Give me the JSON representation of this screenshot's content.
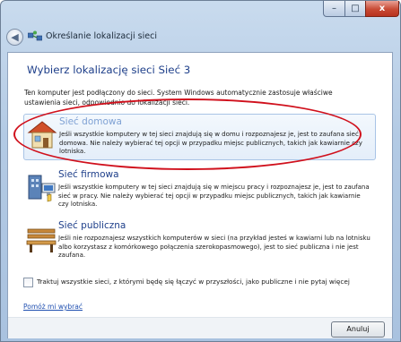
{
  "window": {
    "title": "Określanie lokalizacji sieci",
    "controls": {
      "minimize": "–",
      "maximize": "□",
      "close": "x"
    }
  },
  "heading": "Wybierz lokalizację sieci Sieć 3",
  "intro": "Ten komputer jest podłączony do sieci. System Windows automatycznie zastosuje właściwe ustawienia sieci, odpowiednio do lokalizacji sieci.",
  "options": [
    {
      "title": "Sieć domowa",
      "description": "Jeśli wszystkie komputery w tej sieci znajdują się w domu i rozpoznajesz je, jest to zaufana sieć domowa. Nie należy wybierać tej opcji w przypadku miejsc publicznych, takich jak kawiarnie czy lotniska.",
      "icon": "house-icon"
    },
    {
      "title": "Sieć firmowa",
      "description": "Jeśli wszystkie komputery w tej sieci znajdują się w miejscu pracy i rozpoznajesz je, jest to zaufana sieć w pracy. Nie należy wybierać tej opcji w przypadku miejsc publicznych, takich jak kawiarnie czy lotniska.",
      "icon": "office-network-icon"
    },
    {
      "title": "Sieć publiczna",
      "description": "Jeśli nie rozpoznajesz wszystkich komputerów w sieci (na przykład jesteś w kawiarni lub na lotnisku albo korzystasz z komórkowego połączenia szerokopasmowego), jest to sieć publiczna i nie jest zaufana.",
      "icon": "park-bench-icon"
    }
  ],
  "checkbox": {
    "label": "Traktuj wszystkie sieci, z którymi będę się łączyć w przyszłości, jako publiczne i nie pytaj więcej",
    "checked": false
  },
  "help_link": "Pomóż mi wybrać",
  "cancel_label": "Anuluj",
  "annotation_color": "#d0101c"
}
